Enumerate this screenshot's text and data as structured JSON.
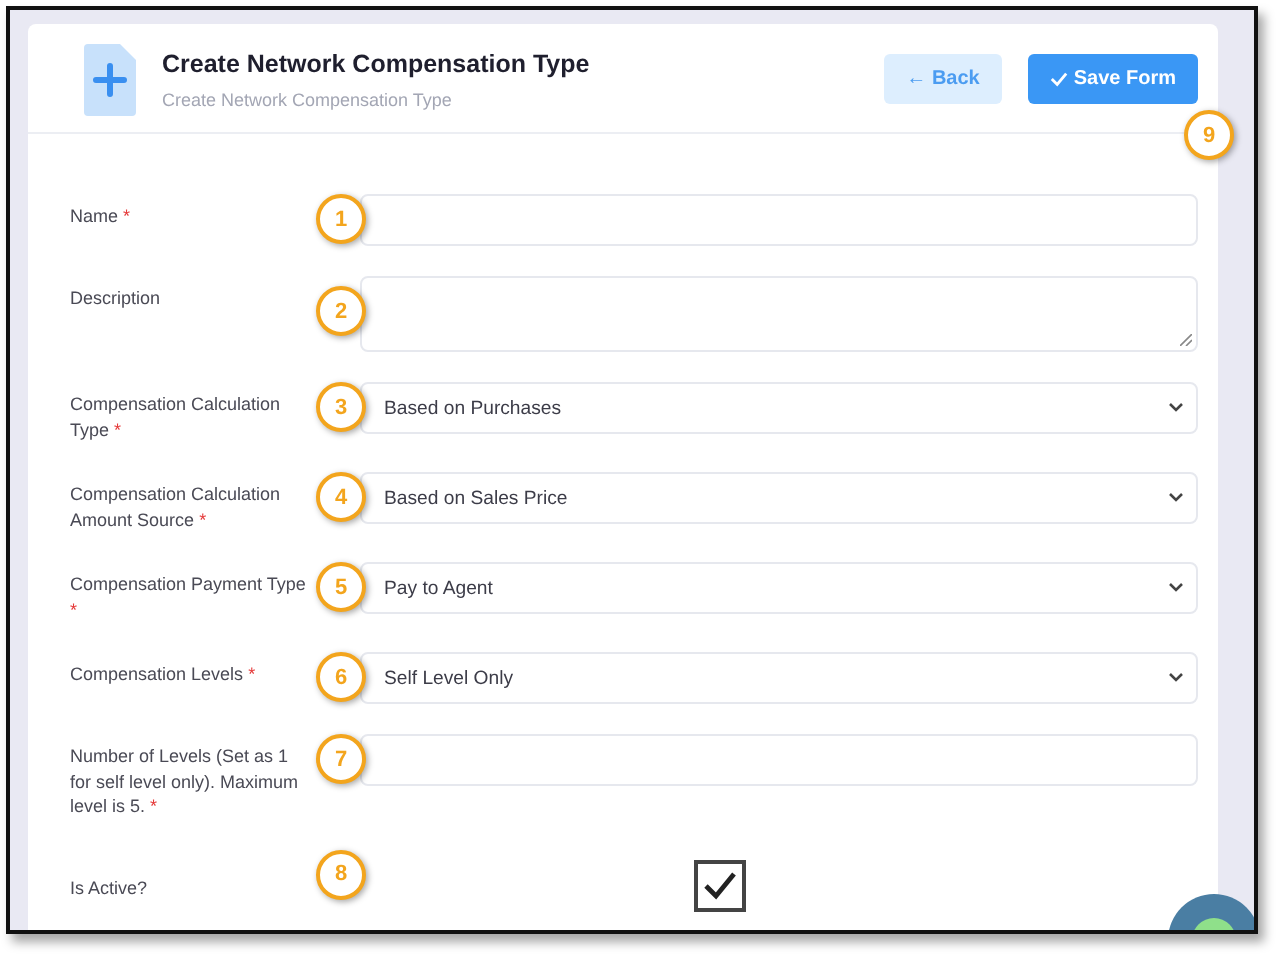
{
  "header": {
    "title": "Create Network Compensation Type",
    "subtitle": "Create Network Compensation Type",
    "back_button": "← Back",
    "save_button": "Save Form",
    "save_badge": "9"
  },
  "fields": [
    {
      "kind": "input",
      "label": "Name",
      "required_mark": "*",
      "badge": "1"
    },
    {
      "kind": "textarea",
      "label": "Description",
      "badge": "2"
    },
    {
      "kind": "select",
      "label": "Compensation Calculation Type",
      "required_mark": "*",
      "badge": "3",
      "value": "Based on Purchases"
    },
    {
      "kind": "select",
      "label": "Compensation Calculation Amount Source",
      "required_mark": "*",
      "badge": "4",
      "value": "Based on Sales Price"
    },
    {
      "kind": "select",
      "label": "Compensation Payment Type",
      "required_mark": "*",
      "badge": "5",
      "value": "Pay to Agent"
    },
    {
      "kind": "select",
      "label": "Compensation Levels",
      "required_mark": "*",
      "badge": "6",
      "value": "Self Level Only"
    },
    {
      "kind": "input",
      "label": "Number of Levels (Set as 1 for self level only). Maximum level is 5.",
      "required_mark": "*",
      "badge": "7"
    },
    {
      "kind": "checkbox",
      "label": "Is Active?",
      "badge": "8",
      "checked": true
    }
  ]
}
